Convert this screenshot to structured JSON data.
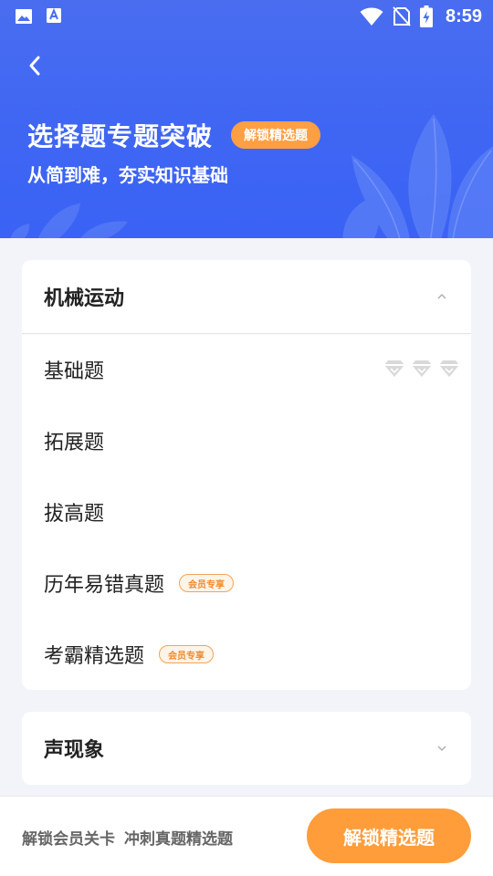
{
  "status_bar": {
    "time": "8:59",
    "icons": [
      "image-icon",
      "a-badge-icon",
      "wifi-icon",
      "no-sim-icon",
      "battery-charging-icon"
    ]
  },
  "header": {
    "back_icon": "chevron-left-icon",
    "title": "选择题专题突破",
    "badge": "解锁精选题",
    "subtitle": "从简到难，夯实知识基础",
    "colors": {
      "start": "#4a6df0",
      "end": "#3a62f4"
    }
  },
  "sections": [
    {
      "title": "机械运动",
      "expanded": true,
      "items": [
        {
          "label": "基础题",
          "gems": 3
        },
        {
          "label": "拓展题"
        },
        {
          "label": "拔高题"
        },
        {
          "label": "历年易错真题",
          "badge": "会员专享"
        },
        {
          "label": "考霸精选题",
          "badge": "会员专享"
        }
      ]
    },
    {
      "title": "声现象",
      "expanded": false
    }
  ],
  "bottom_bar": {
    "note_1": "解锁会员关卡",
    "note_2": "冲刺真题精选题",
    "cta": "解锁精选题",
    "accent": "#ff9d3a"
  }
}
